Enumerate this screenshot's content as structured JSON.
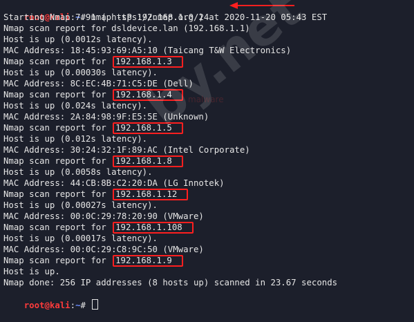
{
  "prompt": {
    "user": "root@kali",
    "path": "~",
    "symbol": "# "
  },
  "command": "nmap -sP 192.168.1.0/24",
  "output": {
    "starting": "Starting Nmap 7.91 ( https://nmap.org ) at 2020-11-20 05:43 EST",
    "report_prefix": "Nmap scan report for ",
    "hosts": [
      {
        "name": "dsldevice.lan (192.168.1.1)",
        "boxed": false,
        "up": "Host is up (0.0012s latency).",
        "mac": "MAC Address: 18:45:93:69:A5:10 (Taicang T&W Electronics)"
      },
      {
        "name": "192.168.1.3",
        "boxed": true,
        "up": "Host is up (0.00030s latency).",
        "mac": "MAC Address: 8C:EC:4B:71:C5:DE (Dell)"
      },
      {
        "name": "192.168.1.4",
        "boxed": true,
        "up": "Host is up (0.024s latency).",
        "mac": "MAC Address: 2A:84:98:9F:E5:5E (Unknown)"
      },
      {
        "name": "192.168.1.5",
        "boxed": true,
        "up": "Host is up (0.012s latency).",
        "mac": "MAC Address: 30:24:32:1F:89:AC (Intel Corporate)"
      },
      {
        "name": "192.168.1.8",
        "boxed": true,
        "up": "Host is up (0.0058s latency).",
        "mac": "MAC Address: 44:CB:8B:C2:20:DA (LG Innotek)"
      },
      {
        "name": "192.168.1.12",
        "boxed": true,
        "up": "Host is up (0.00027s latency).",
        "mac": "MAC Address: 00:0C:29:78:20:90 (VMware)"
      },
      {
        "name": "192.168.1.108",
        "boxed": true,
        "up": "Host is up (0.00017s latency).",
        "mac": "MAC Address: 00:0C:29:C8:9C:50 (VMware)"
      },
      {
        "name": "192.168.1.9",
        "boxed": true,
        "up": "Host is up.",
        "mac": null
      }
    ],
    "done": "Nmap done: 256 IP addresses (8 hosts up) scanned in 23.67 seconds"
  },
  "watermark": "by.net",
  "watermark_small": "malware",
  "colors": {
    "background": "#1c1f2b",
    "user": "#ff3b3b",
    "path": "#6a8dff",
    "highlight_box": "#ff1f1f",
    "arrow": "#ff1f1f",
    "text": "#e6e6e6"
  }
}
